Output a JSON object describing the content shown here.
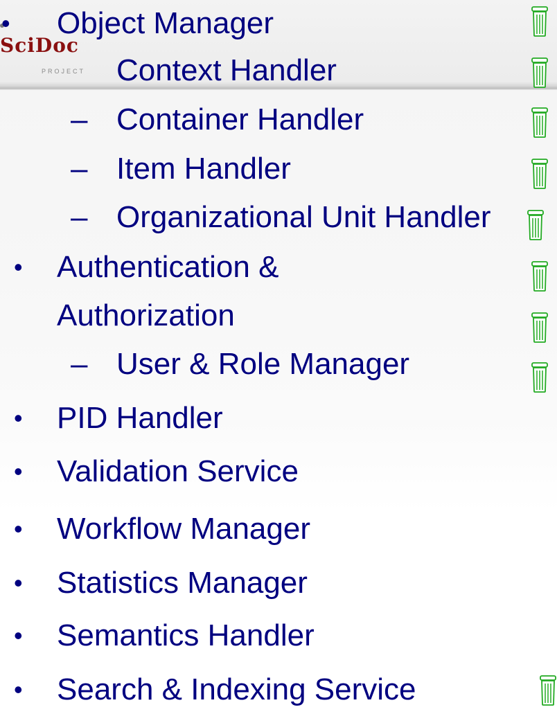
{
  "logo": {
    "name": "SciDoc",
    "subtitle": "PROJECT"
  },
  "bullet_char": "•",
  "dash_char": "–",
  "items": [
    {
      "label": "Object Manager",
      "level": 1,
      "trash": true
    },
    {
      "label": "Context Handler",
      "level": 2,
      "trash": true
    },
    {
      "label": "Container Handler",
      "level": 2,
      "trash": true
    },
    {
      "label": "Item Handler",
      "level": 2,
      "trash": true
    },
    {
      "label": "Organizational Unit Handler",
      "level": 2,
      "trash": true
    },
    {
      "label": "Authentication &",
      "level": 1,
      "trash": true
    },
    {
      "label": "Authorization",
      "level": 1,
      "trash": true
    },
    {
      "label": "User & Role Manager",
      "level": 2,
      "trash": true
    },
    {
      "label": "PID Handler",
      "level": 1,
      "trash": false
    },
    {
      "label": "Validation Service",
      "level": 1,
      "trash": false
    },
    {
      "label": "Workflow Manager",
      "level": 1,
      "trash": false
    },
    {
      "label": "Statistics Manager",
      "level": 1,
      "trash": false
    },
    {
      "label": "Semantics Handler",
      "level": 1,
      "trash": false
    },
    {
      "label": "Search & Indexing Service",
      "level": 1,
      "trash": true
    }
  ],
  "icon_names": {
    "trash": "trash-can-icon"
  },
  "colors": {
    "text": "#000080",
    "icon": "#22aa22",
    "logo": "#8a1010"
  }
}
